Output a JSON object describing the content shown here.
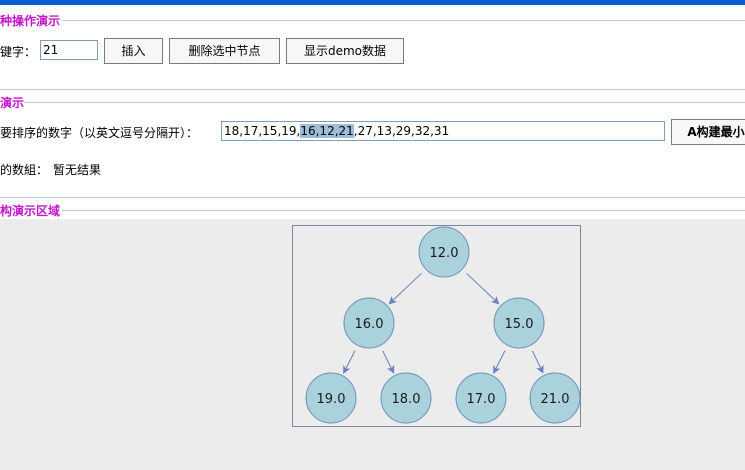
{
  "colors": {
    "accent_title": "#c01ac8",
    "node_fill": "#a9d2dc",
    "node_stroke": "#6a8fb8",
    "edge": "#6a80c0"
  },
  "section1": {
    "title": "种操作演示",
    "key_label": "键字：",
    "key_value": "21",
    "insert_button": "插入",
    "delete_button": "删除选中节点",
    "demo_button": "显示demo数据"
  },
  "section2": {
    "title": "演示",
    "input_label": "要排序的数字（以英文逗号分隔开）：",
    "input_before": "18,17,15,19,",
    "input_selected": "16,12,21",
    "input_after": ",27,13,29,32,31",
    "build_button": "A构建最小",
    "result_label": "的数組：",
    "result_value": "暂无结果"
  },
  "section3": {
    "title": "构演示区域"
  },
  "tree": {
    "nodes": [
      {
        "label": "12.0"
      },
      {
        "label": "16.0"
      },
      {
        "label": "15.0"
      },
      {
        "label": "19.0"
      },
      {
        "label": "18.0"
      },
      {
        "label": "17.0"
      },
      {
        "label": "21.0"
      }
    ],
    "edges": [
      [
        0,
        1
      ],
      [
        0,
        2
      ],
      [
        1,
        3
      ],
      [
        1,
        4
      ],
      [
        2,
        5
      ],
      [
        2,
        6
      ]
    ]
  }
}
